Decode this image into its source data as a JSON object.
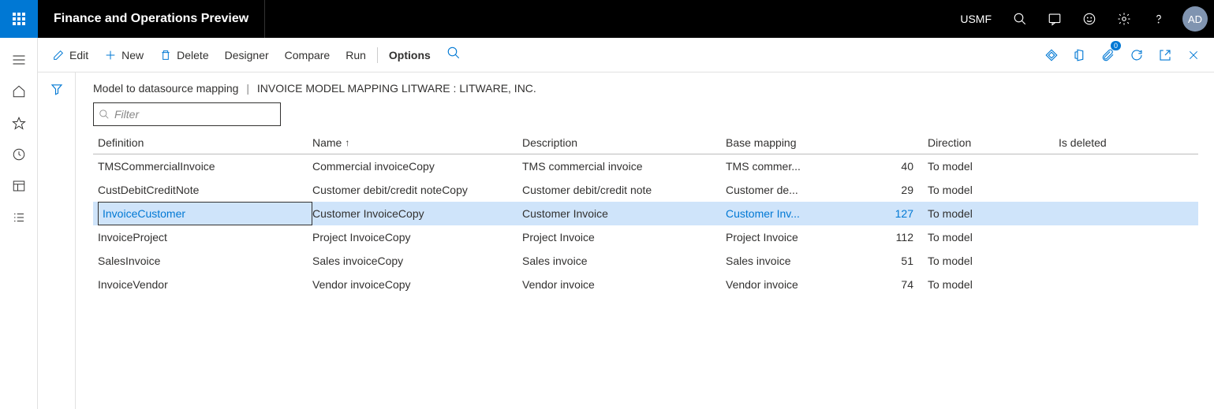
{
  "header": {
    "app_title": "Finance and Operations Preview",
    "company": "USMF",
    "avatar": "AD"
  },
  "toolbar": {
    "edit": "Edit",
    "new": "New",
    "delete": "Delete",
    "designer": "Designer",
    "compare": "Compare",
    "run": "Run",
    "options": "Options",
    "attach_badge": "0"
  },
  "breadcrumb": {
    "part1": "Model to datasource mapping",
    "sep": "|",
    "part2": "INVOICE MODEL MAPPING LITWARE : LITWARE, INC."
  },
  "filter": {
    "placeholder": "Filter"
  },
  "grid": {
    "headers": {
      "definition": "Definition",
      "name": "Name",
      "description": "Description",
      "base_mapping": "Base mapping",
      "direction": "Direction",
      "is_deleted": "Is deleted"
    },
    "rows": [
      {
        "definition": "TMSCommercialInvoice",
        "name": "Commercial invoiceCopy",
        "description": "TMS commercial invoice",
        "base_mapping": "TMS commer...",
        "num": "40",
        "direction": "To model",
        "selected": false
      },
      {
        "definition": "CustDebitCreditNote",
        "name": "Customer debit/credit noteCopy",
        "description": "Customer debit/credit note",
        "base_mapping": "Customer de...",
        "num": "29",
        "direction": "To model",
        "selected": false
      },
      {
        "definition": "InvoiceCustomer",
        "name": "Customer InvoiceCopy",
        "description": "Customer Invoice",
        "base_mapping": "Customer Inv...",
        "num": "127",
        "direction": "To model",
        "selected": true
      },
      {
        "definition": "InvoiceProject",
        "name": "Project InvoiceCopy",
        "description": "Project Invoice",
        "base_mapping": "Project Invoice",
        "num": "112",
        "direction": "To model",
        "selected": false
      },
      {
        "definition": "SalesInvoice",
        "name": "Sales invoiceCopy",
        "description": "Sales invoice",
        "base_mapping": "Sales invoice",
        "num": "51",
        "direction": "To model",
        "selected": false
      },
      {
        "definition": "InvoiceVendor",
        "name": "Vendor invoiceCopy",
        "description": "Vendor invoice",
        "base_mapping": "Vendor invoice",
        "num": "74",
        "direction": "To model",
        "selected": false
      }
    ]
  }
}
